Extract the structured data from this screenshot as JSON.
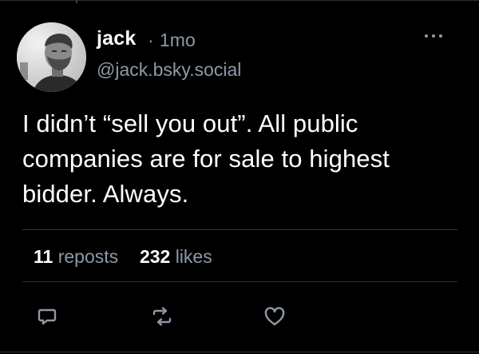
{
  "post": {
    "author": {
      "display_name": "jack",
      "handle": "@jack.bsky.social",
      "avatar_icon": "avatar-photo"
    },
    "separator": "·",
    "time_ago": "1mo",
    "text": "I didn’t “sell you out”. All public companies are for sale to highest bidder. Always.",
    "stats": {
      "reposts_count": "11",
      "reposts_label": "reposts",
      "likes_count": "232",
      "likes_label": "likes"
    },
    "actions": [
      {
        "name": "reply",
        "icon": "speech-bubble-icon"
      },
      {
        "name": "repost",
        "icon": "repost-arrows-icon"
      },
      {
        "name": "like",
        "icon": "heart-icon"
      }
    ],
    "menu_icon": "ellipsis-icon"
  },
  "colors": {
    "background": "#000000",
    "text_primary": "#ffffff",
    "text_secondary": "#8d99a6",
    "divider": "#2f3338"
  }
}
